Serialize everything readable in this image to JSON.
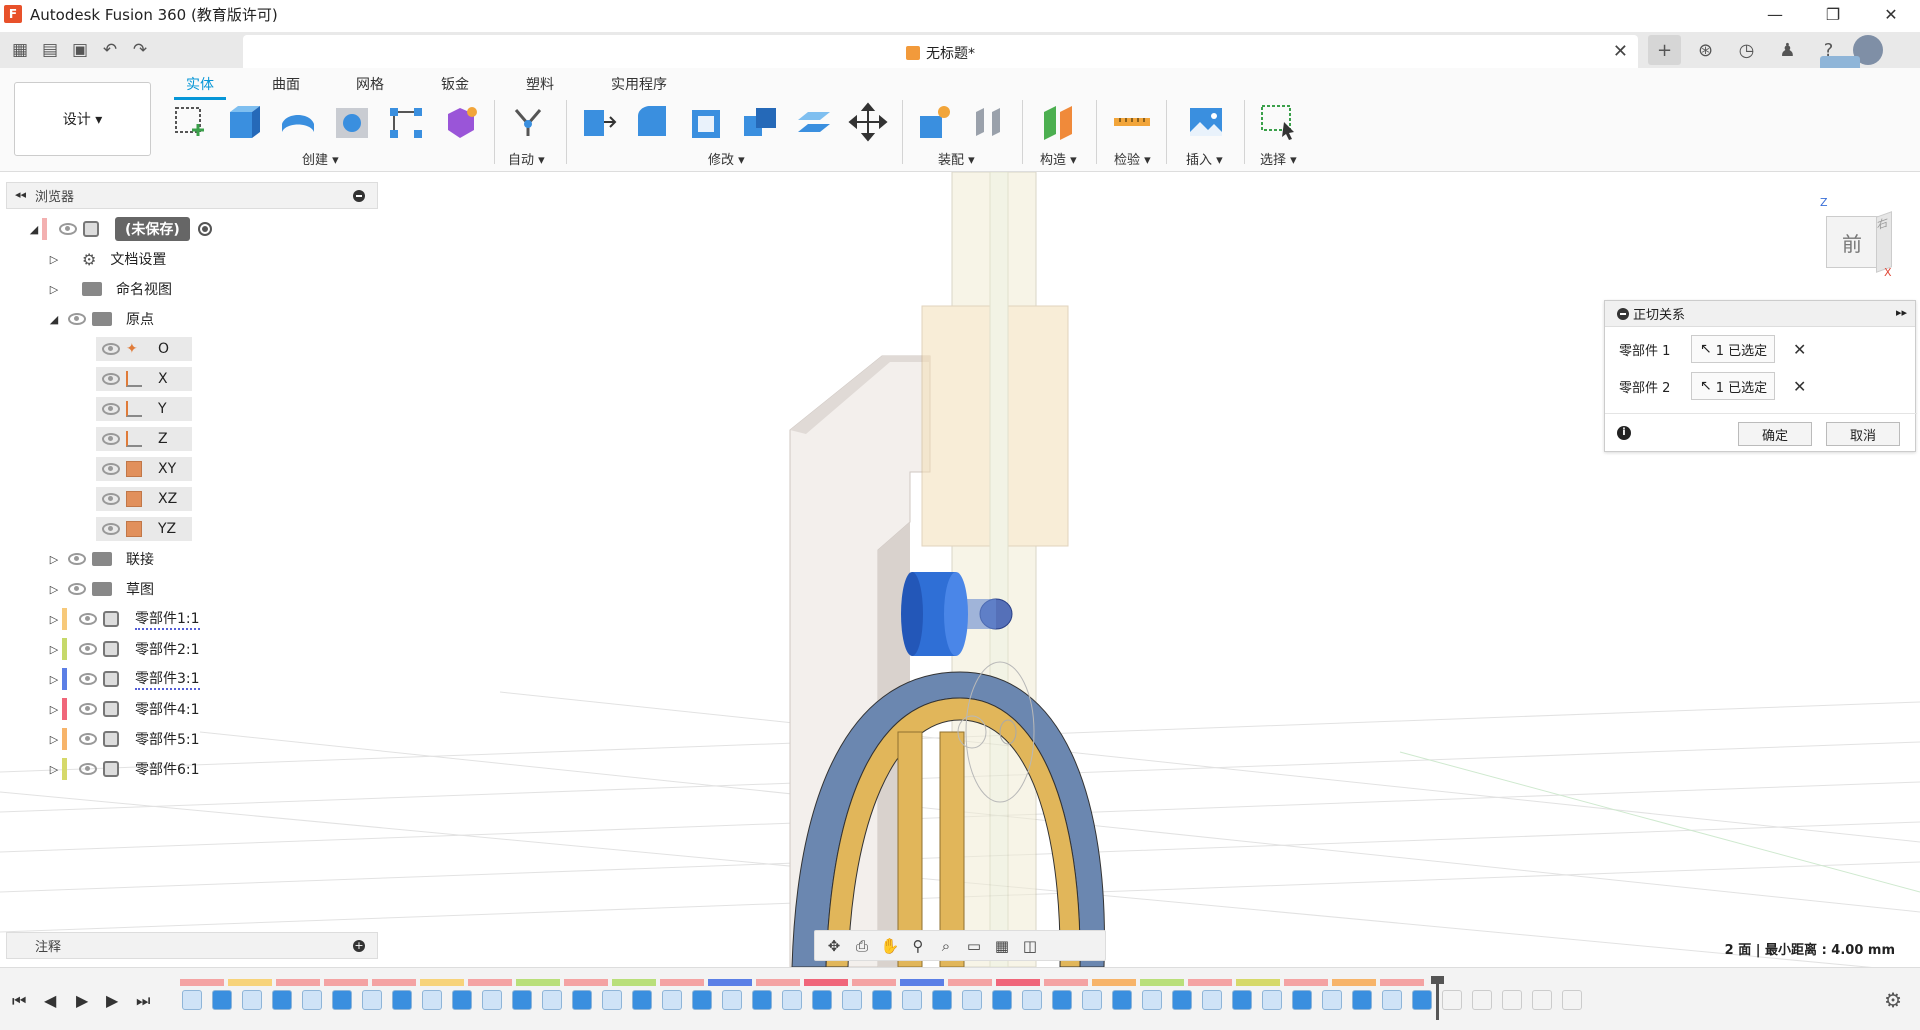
{
  "titlebar": {
    "app_title": "Autodesk Fusion 360 (教育版许可)",
    "logo_letter": "F",
    "minimize": "—",
    "restore": "❐",
    "close": "✕"
  },
  "tabbar": {
    "doc_title": "无标题*",
    "close": "✕",
    "plus": "+"
  },
  "ribbon": {
    "workspace": "设计 ▾",
    "tabs": [
      "实体",
      "曲面",
      "网格",
      "钣金",
      "塑料",
      "实用程序"
    ],
    "active_tab": "实体",
    "groups": {
      "create": "创建 ▾",
      "automate": "自动 ▾",
      "modify": "修改 ▾",
      "assemble": "装配 ▾",
      "construct": "构造 ▾",
      "inspect": "检验 ▾",
      "insert": "插入 ▾",
      "select": "选择 ▾"
    }
  },
  "browser": {
    "title": "浏览器",
    "collapse": "◂◂",
    "root": "(未保存)",
    "items": {
      "doc_settings": "文档设置",
      "named_views": "命名视图",
      "origin": "原点",
      "o": "O",
      "x": "X",
      "y": "Y",
      "z": "Z",
      "xy": "XY",
      "xz": "XZ",
      "yz": "YZ",
      "joints": "联接",
      "sketches": "草图"
    },
    "components": [
      {
        "name": "零部件1:1",
        "color": "#f7c97a"
      },
      {
        "name": "零部件2:1",
        "color": "#c6d96a"
      },
      {
        "name": "零部件3:1",
        "color": "#5b7fe6"
      },
      {
        "name": "零部件4:1",
        "color": "#f0667a"
      },
      {
        "name": "零部件5:1",
        "color": "#f7b46a"
      },
      {
        "name": "零部件6:1",
        "color": "#d6d96a"
      }
    ]
  },
  "notes_panel": {
    "title": "注释"
  },
  "viewcube": {
    "front": "前",
    "right": "右",
    "z_axis": "Z",
    "x_axis": "X"
  },
  "tangent_dialog": {
    "title": "正切关系",
    "expand": "▸▸",
    "component1_label": "零部件 1",
    "component2_label": "零部件 2",
    "selection1": "1 已选定",
    "selection2": "1 已选定",
    "ok": "确定",
    "cancel": "取消",
    "info": "i"
  },
  "status": {
    "measure": "2 面 | 最小距离 : 4.00 mm"
  },
  "timeline": {
    "first": "⏮",
    "prev": "◀",
    "play": "▶",
    "next": "▶",
    "last": "⏭",
    "settings": "⚙"
  },
  "colors": {
    "accent": "#0696d7",
    "blue_part": "#2f6fd6",
    "gold_part": "#e1b65a",
    "steel_part": "#6b87b0"
  }
}
